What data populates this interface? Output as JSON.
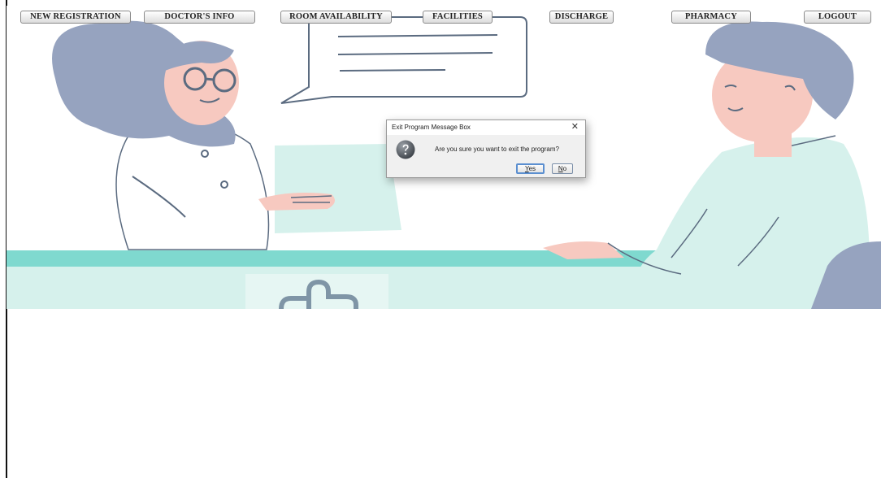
{
  "nav": {
    "items": [
      {
        "label": "NEW REGISTRATION"
      },
      {
        "label": "DOCTOR'S INFO"
      },
      {
        "label": "ROOM AVAILABILITY"
      },
      {
        "label": "FACILITIES"
      },
      {
        "label": "DISCHARGE"
      },
      {
        "label": "PHARMACY"
      },
      {
        "label": "LOGOUT"
      }
    ]
  },
  "dialog": {
    "title": "Exit Program Message Box",
    "close_glyph": "✕",
    "message": "Are you sure you want to exit the program?",
    "yes_mnemonic": "Y",
    "yes_rest": "es",
    "no_mnemonic": "N",
    "no_rest": "o",
    "icon": "question-icon"
  },
  "colors": {
    "teal": "#7fd9cf",
    "mint": "#d6f1ec",
    "hair": "#96a3bf",
    "skin": "#f7c9c0",
    "focus_border": "#5b8fd0"
  }
}
